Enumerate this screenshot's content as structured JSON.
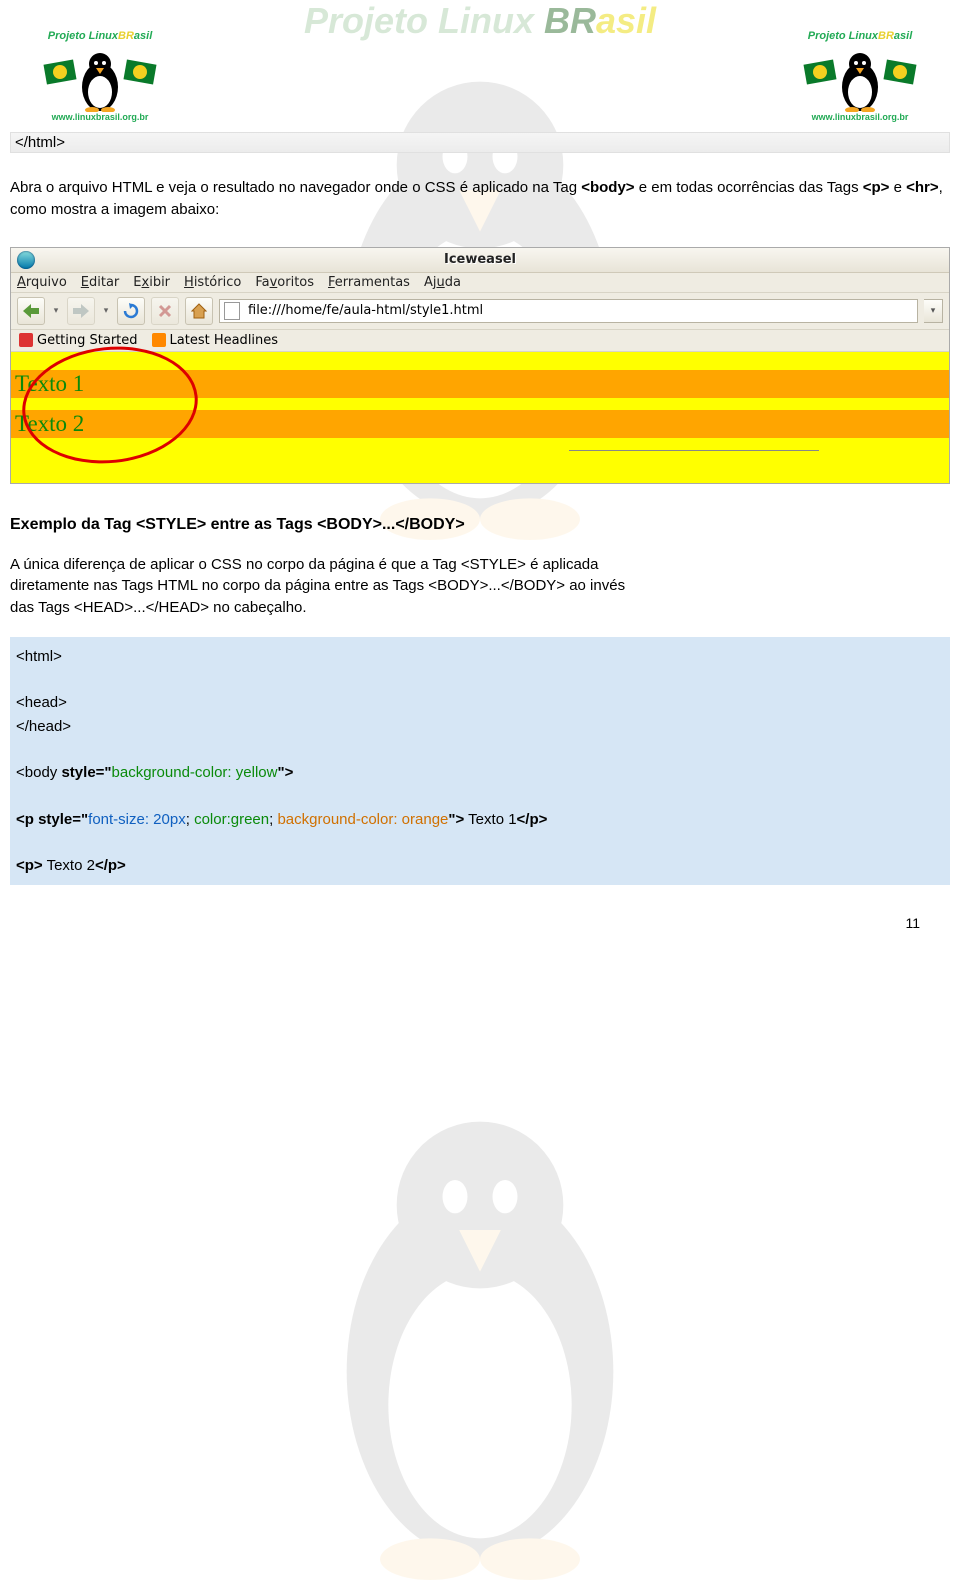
{
  "watermark": {
    "title_prefix": "Projeto Linux ",
    "title_b": "BR",
    "title_suffix": "asil"
  },
  "logo": {
    "title_prefix": "Projeto Linux",
    "title_b": "BR",
    "title_suffix": "asil",
    "url": "www.linuxbrasil.org.br"
  },
  "snippet_close_html": "</html>",
  "intro_paragraph": {
    "pre": "Abra o arquivo HTML e veja o resultado no navegador onde o CSS é aplicado na Tag ",
    "b1": "<body>",
    "mid1": " e em todas ocorrências das Tags ",
    "b2": "<p>",
    "mid2": " e ",
    "b3": "<hr>",
    "post": ", como mostra a imagem abaixo:"
  },
  "browser": {
    "title": "Iceweasel",
    "menus": [
      "Arquivo",
      "Editar",
      "Exibir",
      "Histórico",
      "Favoritos",
      "Ferramentas",
      "Ajuda"
    ],
    "url": "file:///home/fe/aula-html/style1.html",
    "bookmarks": [
      "Getting Started",
      "Latest Headlines"
    ],
    "texto1": "Texto 1",
    "texto2": "Texto 2"
  },
  "heading2": "Exemplo da Tag <STYLE> entre as Tags <BODY>...</BODY>",
  "explanation": "A única diferença de aplicar o CSS no corpo da página é que a Tag <STYLE> é aplicada diretamente nas Tags HTML no corpo da página entre as Tags <BODY>...</BODY> ao invés das Tags <HEAD>...</HEAD> no cabeçalho.",
  "code2": {
    "l1": "<html>",
    "l2": "<head>",
    "l3": "</head>",
    "body_open_1": "<body ",
    "body_style_kw": "style=\"",
    "body_style_val": "background-color: yellow",
    "body_close_q": "\">",
    "p1_open": "<p style=\"",
    "p1_s1": "font-size: 20px",
    "p1_sep": "; ",
    "p1_s2": "color:green",
    "p1_s3": "background-color: orange",
    "p1_close_q": "\">",
    "p1_text": " Texto 1",
    "p1_close": "</p>",
    "p2_open": "<p>",
    "p2_text": " Texto 2",
    "p2_close": "</p>"
  },
  "page_number": "11"
}
